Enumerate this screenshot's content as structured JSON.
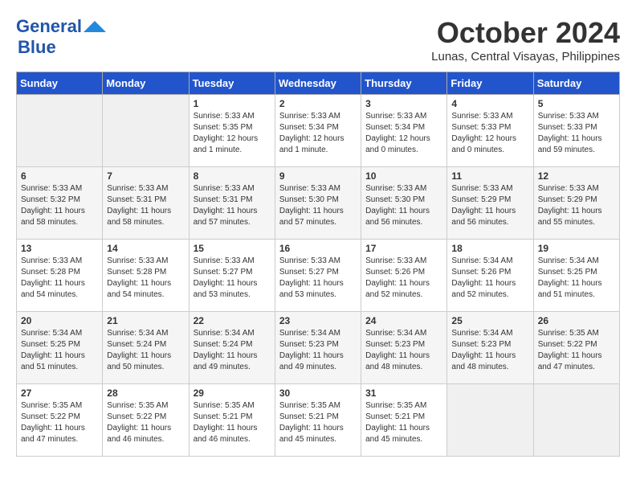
{
  "header": {
    "logo_line1": "General",
    "logo_line2": "Blue",
    "month_title": "October 2024",
    "location": "Lunas, Central Visayas, Philippines"
  },
  "weekdays": [
    "Sunday",
    "Monday",
    "Tuesday",
    "Wednesday",
    "Thursday",
    "Friday",
    "Saturday"
  ],
  "weeks": [
    [
      {
        "day": "",
        "info": ""
      },
      {
        "day": "",
        "info": ""
      },
      {
        "day": "1",
        "info": "Sunrise: 5:33 AM\nSunset: 5:35 PM\nDaylight: 12 hours\nand 1 minute."
      },
      {
        "day": "2",
        "info": "Sunrise: 5:33 AM\nSunset: 5:34 PM\nDaylight: 12 hours\nand 1 minute."
      },
      {
        "day": "3",
        "info": "Sunrise: 5:33 AM\nSunset: 5:34 PM\nDaylight: 12 hours\nand 0 minutes."
      },
      {
        "day": "4",
        "info": "Sunrise: 5:33 AM\nSunset: 5:33 PM\nDaylight: 12 hours\nand 0 minutes."
      },
      {
        "day": "5",
        "info": "Sunrise: 5:33 AM\nSunset: 5:33 PM\nDaylight: 11 hours\nand 59 minutes."
      }
    ],
    [
      {
        "day": "6",
        "info": "Sunrise: 5:33 AM\nSunset: 5:32 PM\nDaylight: 11 hours\nand 58 minutes."
      },
      {
        "day": "7",
        "info": "Sunrise: 5:33 AM\nSunset: 5:31 PM\nDaylight: 11 hours\nand 58 minutes."
      },
      {
        "day": "8",
        "info": "Sunrise: 5:33 AM\nSunset: 5:31 PM\nDaylight: 11 hours\nand 57 minutes."
      },
      {
        "day": "9",
        "info": "Sunrise: 5:33 AM\nSunset: 5:30 PM\nDaylight: 11 hours\nand 57 minutes."
      },
      {
        "day": "10",
        "info": "Sunrise: 5:33 AM\nSunset: 5:30 PM\nDaylight: 11 hours\nand 56 minutes."
      },
      {
        "day": "11",
        "info": "Sunrise: 5:33 AM\nSunset: 5:29 PM\nDaylight: 11 hours\nand 56 minutes."
      },
      {
        "day": "12",
        "info": "Sunrise: 5:33 AM\nSunset: 5:29 PM\nDaylight: 11 hours\nand 55 minutes."
      }
    ],
    [
      {
        "day": "13",
        "info": "Sunrise: 5:33 AM\nSunset: 5:28 PM\nDaylight: 11 hours\nand 54 minutes."
      },
      {
        "day": "14",
        "info": "Sunrise: 5:33 AM\nSunset: 5:28 PM\nDaylight: 11 hours\nand 54 minutes."
      },
      {
        "day": "15",
        "info": "Sunrise: 5:33 AM\nSunset: 5:27 PM\nDaylight: 11 hours\nand 53 minutes."
      },
      {
        "day": "16",
        "info": "Sunrise: 5:33 AM\nSunset: 5:27 PM\nDaylight: 11 hours\nand 53 minutes."
      },
      {
        "day": "17",
        "info": "Sunrise: 5:33 AM\nSunset: 5:26 PM\nDaylight: 11 hours\nand 52 minutes."
      },
      {
        "day": "18",
        "info": "Sunrise: 5:34 AM\nSunset: 5:26 PM\nDaylight: 11 hours\nand 52 minutes."
      },
      {
        "day": "19",
        "info": "Sunrise: 5:34 AM\nSunset: 5:25 PM\nDaylight: 11 hours\nand 51 minutes."
      }
    ],
    [
      {
        "day": "20",
        "info": "Sunrise: 5:34 AM\nSunset: 5:25 PM\nDaylight: 11 hours\nand 51 minutes."
      },
      {
        "day": "21",
        "info": "Sunrise: 5:34 AM\nSunset: 5:24 PM\nDaylight: 11 hours\nand 50 minutes."
      },
      {
        "day": "22",
        "info": "Sunrise: 5:34 AM\nSunset: 5:24 PM\nDaylight: 11 hours\nand 49 minutes."
      },
      {
        "day": "23",
        "info": "Sunrise: 5:34 AM\nSunset: 5:23 PM\nDaylight: 11 hours\nand 49 minutes."
      },
      {
        "day": "24",
        "info": "Sunrise: 5:34 AM\nSunset: 5:23 PM\nDaylight: 11 hours\nand 48 minutes."
      },
      {
        "day": "25",
        "info": "Sunrise: 5:34 AM\nSunset: 5:23 PM\nDaylight: 11 hours\nand 48 minutes."
      },
      {
        "day": "26",
        "info": "Sunrise: 5:35 AM\nSunset: 5:22 PM\nDaylight: 11 hours\nand 47 minutes."
      }
    ],
    [
      {
        "day": "27",
        "info": "Sunrise: 5:35 AM\nSunset: 5:22 PM\nDaylight: 11 hours\nand 47 minutes."
      },
      {
        "day": "28",
        "info": "Sunrise: 5:35 AM\nSunset: 5:22 PM\nDaylight: 11 hours\nand 46 minutes."
      },
      {
        "day": "29",
        "info": "Sunrise: 5:35 AM\nSunset: 5:21 PM\nDaylight: 11 hours\nand 46 minutes."
      },
      {
        "day": "30",
        "info": "Sunrise: 5:35 AM\nSunset: 5:21 PM\nDaylight: 11 hours\nand 45 minutes."
      },
      {
        "day": "31",
        "info": "Sunrise: 5:35 AM\nSunset: 5:21 PM\nDaylight: 11 hours\nand 45 minutes."
      },
      {
        "day": "",
        "info": ""
      },
      {
        "day": "",
        "info": ""
      }
    ]
  ]
}
